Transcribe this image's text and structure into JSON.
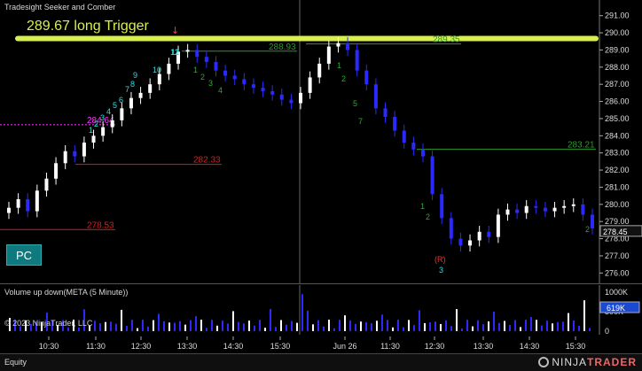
{
  "chart": {
    "title": "Tradesight Seeker and Comber",
    "trigger_text": "289.67 long Trigger",
    "pc_button": "PC",
    "volume_title": "Volume up down(META (5 Minute))",
    "copyright": "© 2023 NinjaTrader, LLC",
    "footer_label": "Equity",
    "brand_prefix": "NINJA",
    "brand_suffix": "TRADER",
    "current_price": "278.45",
    "current_volume": "619K",
    "colors": {
      "up_bar": "#ffffff",
      "down_bar": "#2a2aff",
      "trigger_line": "#d8f04a",
      "level_red": "#cc2222",
      "level_green": "#2a9a2a",
      "magenta": "#ff33ff",
      "cyan": "#33dddd",
      "green_count": "#2eaa2e",
      "background": "#000000"
    }
  },
  "chart_data": {
    "type": "candlestick",
    "price_axis": [
      "291.00",
      "290.00",
      "289.00",
      "288.00",
      "287.00",
      "286.00",
      "285.00",
      "284.00",
      "283.00",
      "282.00",
      "281.00",
      "280.00",
      "279.00",
      "278.00",
      "277.00",
      "276.00"
    ],
    "ylim": [
      275.5,
      291.5
    ],
    "volume_axis": [
      "1000K",
      "500K",
      "0"
    ],
    "time_axis": [
      "10:30",
      "11:30",
      "12:30",
      "13:30",
      "14:30",
      "15:30",
      "Jun 26",
      "11:30",
      "12:30",
      "13:30",
      "14:30",
      "15:30"
    ],
    "levels": [
      {
        "label": "289.67",
        "value": 289.67,
        "kind": "trigger"
      },
      {
        "label": "288.93",
        "value": 288.93,
        "kind": "green"
      },
      {
        "label": "289.35",
        "value": 289.35,
        "kind": "green"
      },
      {
        "label": "283.21",
        "value": 283.21,
        "kind": "green"
      },
      {
        "label": "282.33",
        "value": 282.33,
        "kind": "red"
      },
      {
        "label": "278.53",
        "value": 278.53,
        "kind": "red"
      },
      {
        "label": "284.64",
        "value": 284.64,
        "kind": "magenta"
      }
    ],
    "annotations": [
      "1",
      "2",
      "3",
      "4",
      "5",
      "6",
      "7",
      "8",
      "9",
      "10",
      "11",
      "12",
      "(R)",
      "3"
    ],
    "closes": [
      279.8,
      280.3,
      279.6,
      280.8,
      281.5,
      282.4,
      283.1,
      282.8,
      283.6,
      284.0,
      284.5,
      284.9,
      285.6,
      286.2,
      286.5,
      287.0,
      287.6,
      288.2,
      288.9,
      289.0,
      288.6,
      288.3,
      287.8,
      287.5,
      287.3,
      287.0,
      286.8,
      286.6,
      286.4,
      286.1,
      285.9,
      286.5,
      287.4,
      288.2,
      289.2,
      289.4,
      289.0,
      287.8,
      287.0,
      285.6,
      285.1,
      284.3,
      283.6,
      283.2,
      282.8,
      280.6,
      279.2,
      278.0,
      277.6,
      277.9,
      278.4,
      278.1,
      279.4,
      279.7,
      279.5,
      279.9,
      279.8,
      279.6,
      279.8,
      279.9,
      280.0,
      279.4,
      278.6
    ]
  }
}
